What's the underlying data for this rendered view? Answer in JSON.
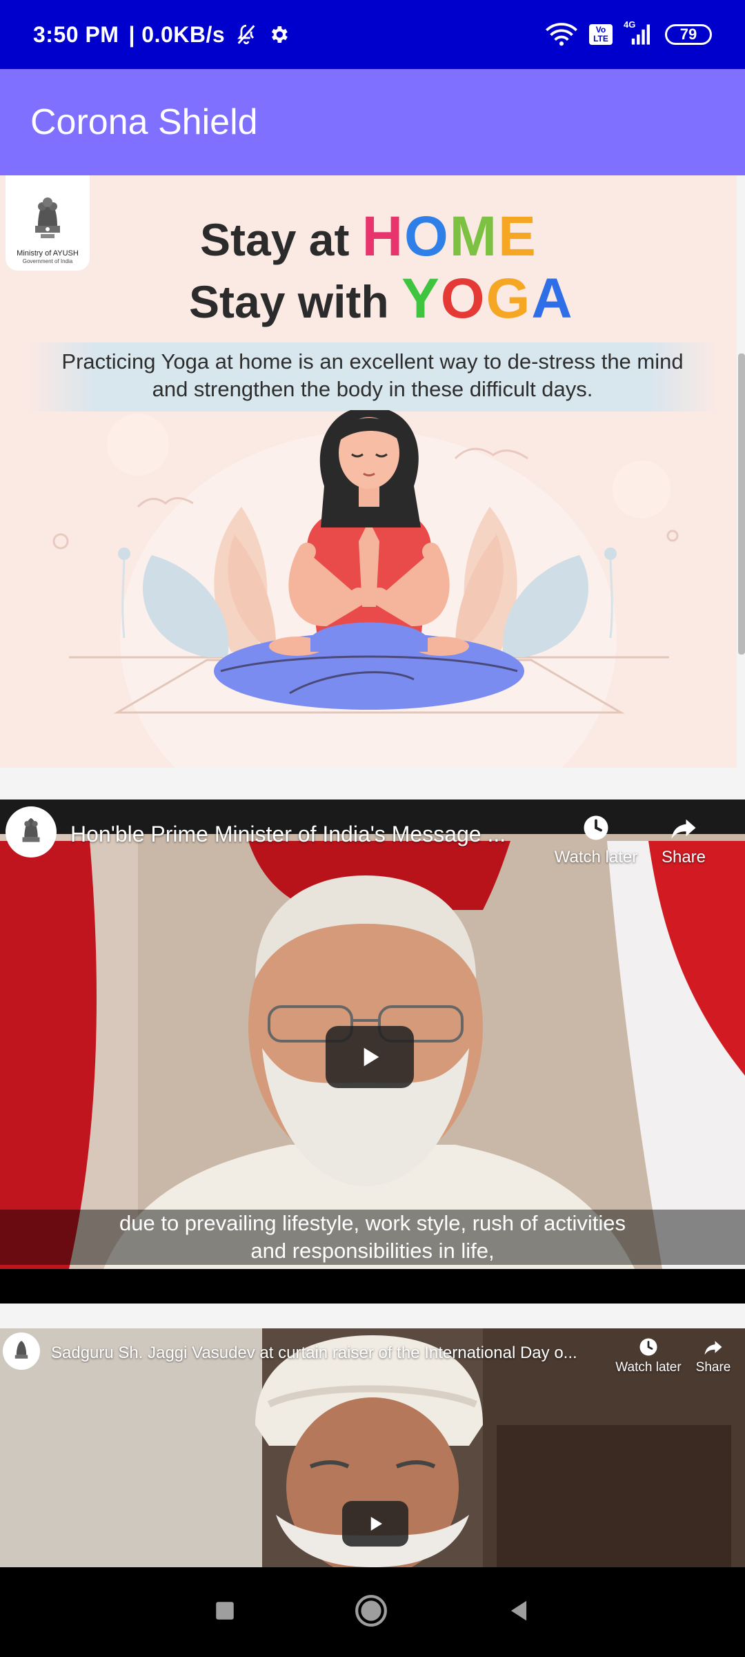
{
  "status_bar": {
    "time": "3:50 PM",
    "speed": "| 0.0KB/s",
    "network": "4G",
    "volte_top": "Vo",
    "volte_bottom": "LTE",
    "battery": "79"
  },
  "app_bar": {
    "title": "Corona Shield"
  },
  "poster": {
    "logo_line1": "Ministry of AYUSH",
    "logo_line2": "Government of India",
    "heading1_prefix": "Stay at ",
    "heading1_word": [
      "H",
      "O",
      "M",
      "E"
    ],
    "heading2_prefix": "Stay with ",
    "heading2_word": [
      "Y",
      "O",
      "G",
      "A"
    ],
    "tagline": "Practicing Yoga at home is an excellent way to de-stress the mind and strengthen the body in these difficult days."
  },
  "videos": [
    {
      "title": "Hon'ble Prime Minister of India's Message ...",
      "watch_later": "Watch later",
      "share": "Share",
      "caption_line1": "due to prevailing lifestyle, work style, rush of activities",
      "caption_line2": "and responsibilities in life,"
    },
    {
      "title": "Sadguru Sh. Jaggi Vasudev at curtain raiser of the International Day o...",
      "watch_later": "Watch later",
      "share": "Share"
    }
  ],
  "colors": {
    "status_bar": "#0000cc",
    "app_bar": "#8070ff",
    "home_letters": [
      "#e8336d",
      "#2e7fe8",
      "#8bc34a",
      "#f5a623"
    ],
    "yoga_letters": [
      "#3ec43e",
      "#e53935",
      "#f5a623",
      "#2e6fe8"
    ]
  }
}
